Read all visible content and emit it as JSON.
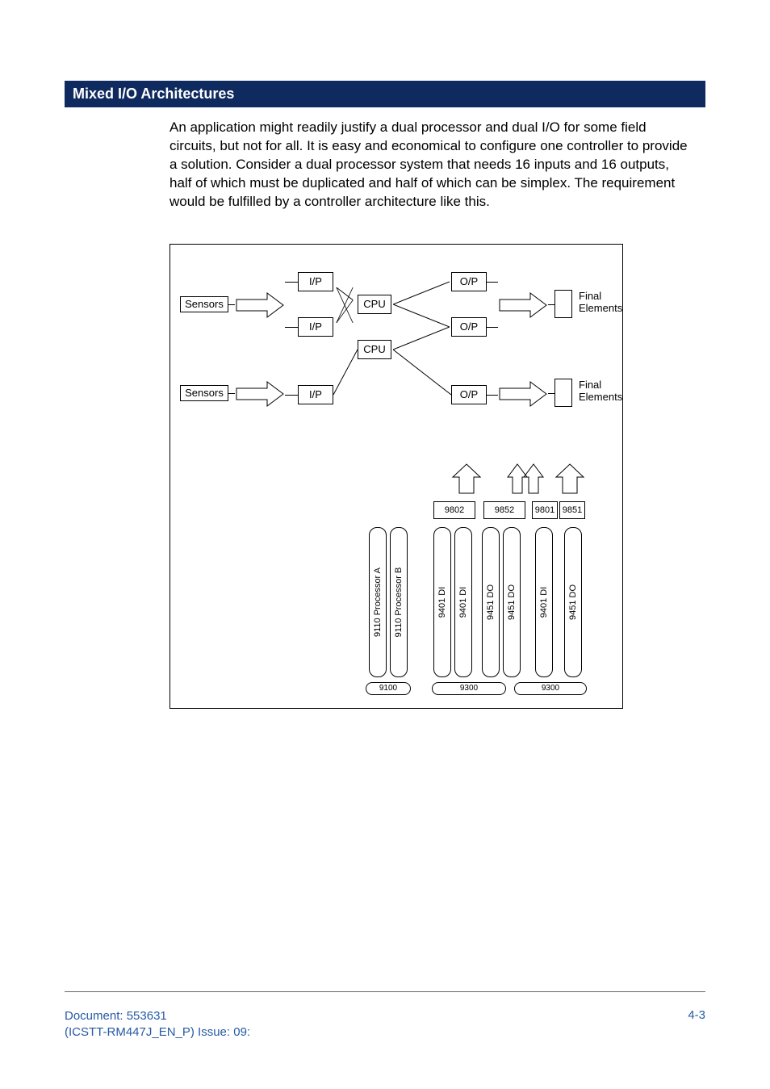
{
  "section_title": "Mixed I/O Architectures",
  "paragraph": "An application might readily justify a dual processor and dual I/O for some field circuits, but not for all. It is easy and economical to configure one controller to provide a solution. Consider a dual processor system that needs 16 inputs and 16 outputs, half of which must be duplicated and half of which can be simplex. The requirement would be fulfilled by a controller architecture like this.",
  "figure": {
    "top": {
      "sensors_label": "Sensors",
      "ip_label": "I/P",
      "cpu_label": "CPU",
      "op_label": "O/P",
      "final_elements_label": "Final\nElements"
    },
    "chassis": {
      "top_labels": {
        "a": "9802",
        "b": "9852",
        "c": "9801",
        "d": "9851"
      },
      "modules": {
        "procA": "9110 Processor A",
        "procB": "9110 Processor B",
        "s1": "9401 DI",
        "s2": "9401 DI",
        "s3": "9451 DO",
        "s4": "9451 DO",
        "s5": "9401 DI",
        "s6": "9451 DO"
      },
      "backplanes": {
        "a": "9100",
        "b": "9300",
        "c": "9300"
      }
    }
  },
  "footer": {
    "doc_line1": "Document: 553631",
    "doc_line2": "(ICSTT-RM447J_EN_P) Issue: 09:",
    "page_num": "4-3"
  }
}
